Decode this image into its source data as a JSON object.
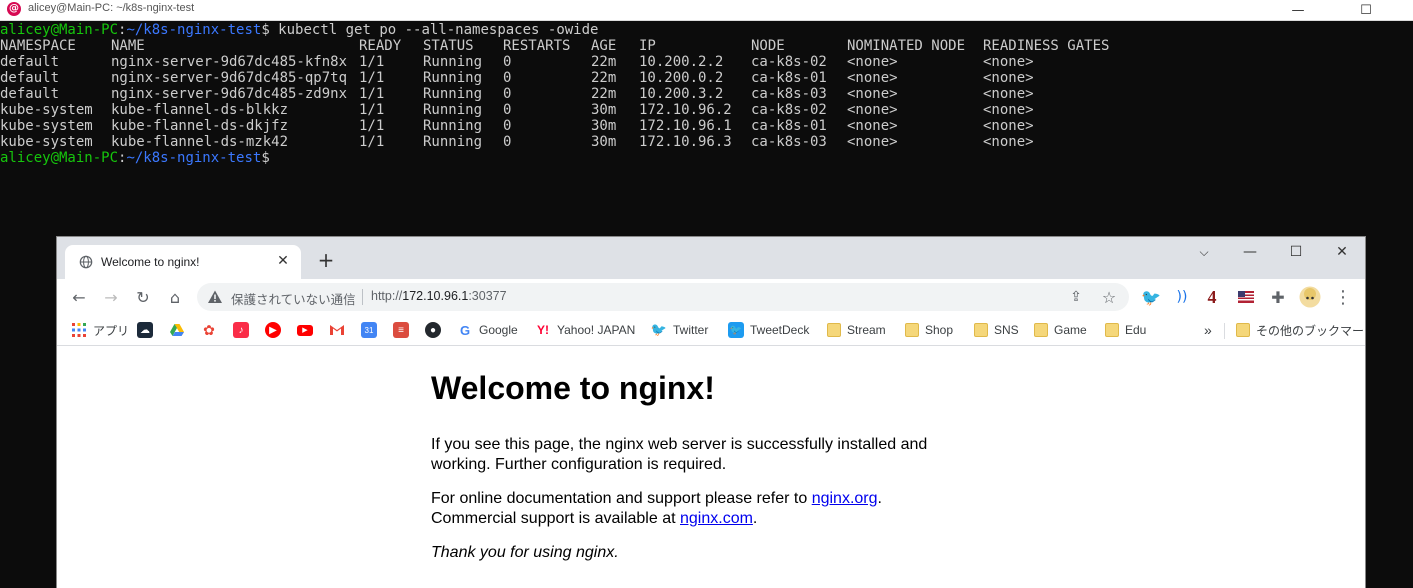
{
  "terminal": {
    "title": "alicey@Main-PC: ~/k8s-nginx-test",
    "prompt_user": "alicey@Main-PC",
    "prompt_sep": ":",
    "prompt_path": "~/k8s-nginx-test",
    "prompt_end": "$",
    "command": " kubectl get po --all-namespaces -owide",
    "columns": [
      "NAMESPACE",
      "NAME",
      "READY",
      "STATUS",
      "RESTARTS",
      "AGE",
      "IP",
      "NODE",
      "NOMINATED NODE",
      "READINESS GATES"
    ],
    "rows": [
      [
        "default",
        "nginx-server-9d67dc485-kfn8x",
        "1/1",
        "Running",
        "0",
        "22m",
        "10.200.2.2",
        "ca-k8s-02",
        "<none>",
        "<none>"
      ],
      [
        "default",
        "nginx-server-9d67dc485-qp7tq",
        "1/1",
        "Running",
        "0",
        "22m",
        "10.200.0.2",
        "ca-k8s-01",
        "<none>",
        "<none>"
      ],
      [
        "default",
        "nginx-server-9d67dc485-zd9nx",
        "1/1",
        "Running",
        "0",
        "22m",
        "10.200.3.2",
        "ca-k8s-03",
        "<none>",
        "<none>"
      ],
      [
        "kube-system",
        "kube-flannel-ds-blkkz",
        "1/1",
        "Running",
        "0",
        "30m",
        "172.10.96.2",
        "ca-k8s-02",
        "<none>",
        "<none>"
      ],
      [
        "kube-system",
        "kube-flannel-ds-dkjfz",
        "1/1",
        "Running",
        "0",
        "30m",
        "172.10.96.1",
        "ca-k8s-01",
        "<none>",
        "<none>"
      ],
      [
        "kube-system",
        "kube-flannel-ds-mzk42",
        "1/1",
        "Running",
        "0",
        "30m",
        "172.10.96.3",
        "ca-k8s-03",
        "<none>",
        "<none>"
      ]
    ]
  },
  "browser": {
    "tab_title": "Welcome to nginx!",
    "insecure_label": "保護されていない通信",
    "url_scheme": "http://",
    "url_host": "172.10.96.1",
    "url_port": ":30377",
    "extension_badge": "4",
    "bookmarks": [
      {
        "label": "アプリ",
        "icon": "apps-grid-icon"
      },
      {
        "label": "",
        "icon": "cloud-icon"
      },
      {
        "label": "",
        "icon": "google-drive-icon"
      },
      {
        "label": "",
        "icon": "google-photos-icon"
      },
      {
        "label": "",
        "icon": "music-icon"
      },
      {
        "label": "",
        "icon": "youtube-music-icon"
      },
      {
        "label": "",
        "icon": "youtube-icon"
      },
      {
        "label": "",
        "icon": "gmail-icon"
      },
      {
        "label": "",
        "icon": "calendar-icon"
      },
      {
        "label": "",
        "icon": "todoist-icon"
      },
      {
        "label": "",
        "icon": "github-icon"
      },
      {
        "label": "Google",
        "icon": "google-icon"
      },
      {
        "label": "Yahoo! JAPAN",
        "icon": "yahoo-icon"
      },
      {
        "label": "Twitter",
        "icon": "twitter-icon"
      },
      {
        "label": "TweetDeck",
        "icon": "tweetdeck-icon"
      },
      {
        "label": "Stream",
        "icon": "folder-icon"
      },
      {
        "label": "Shop",
        "icon": "folder-icon"
      },
      {
        "label": "SNS",
        "icon": "folder-icon"
      },
      {
        "label": "Game",
        "icon": "folder-icon"
      },
      {
        "label": "Edu",
        "icon": "folder-icon"
      }
    ],
    "more_bookmarks": "»",
    "other_bookmarks": "その他のブックマーク"
  },
  "page": {
    "heading": "Welcome to nginx!",
    "p1": "If you see this page, the nginx web server is successfully installed and working. Further configuration is required.",
    "p2_before": "For online documentation and support please refer to ",
    "p2_link1": "nginx.org",
    "p2_mid": ".",
    "p2_line2": "Commercial support is available at ",
    "p2_link2": "nginx.com",
    "p2_end": ".",
    "p3": "Thank you for using nginx."
  }
}
